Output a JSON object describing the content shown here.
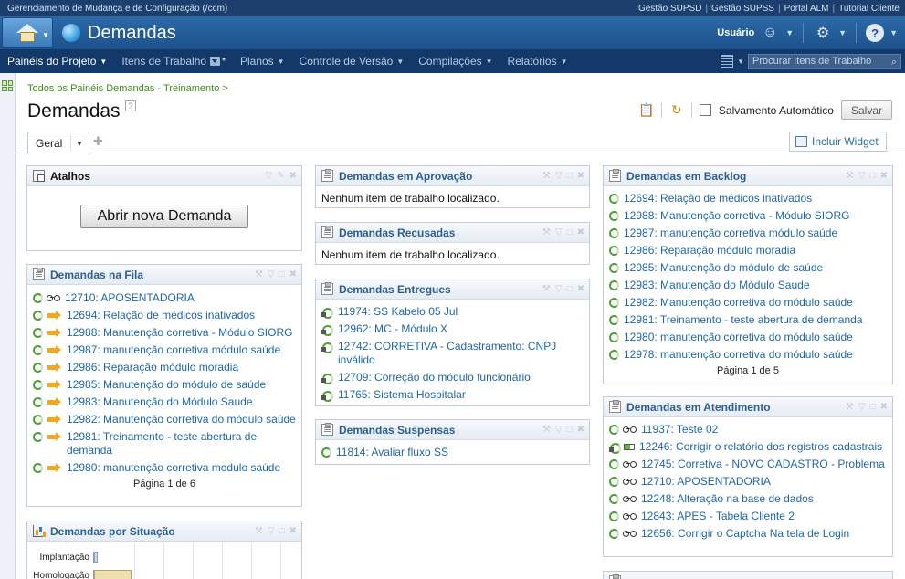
{
  "topstrip": {
    "app_title": "Gerenciamento de Mudança e de Configuração (/ccm)",
    "links": [
      "Gestão SUPSD",
      "Gestão SUPSS",
      "Portal ALM",
      "Tutorial Cliente"
    ]
  },
  "titlebar": {
    "project_title": "Demandas",
    "user_label": "Usuário"
  },
  "nav": {
    "items": [
      {
        "label": "Painéis do Projeto"
      },
      {
        "label": "Itens de Trabalho"
      },
      {
        "label": "Planos"
      },
      {
        "label": "Controle de Versão"
      },
      {
        "label": "Compilações"
      },
      {
        "label": "Relatórios"
      }
    ],
    "search_placeholder": "Procurar Itens de Trabalho"
  },
  "page": {
    "breadcrumb": "Todos os Painéis Demandas - Treinamento >",
    "title": "Demandas",
    "autosave_label": "Salvamento Automático",
    "save_label": "Salvar",
    "add_widget_label": "Incluir Widget",
    "tab_label": "Geral"
  },
  "widgets": {
    "atalhos": {
      "title": "Atalhos",
      "button": "Abrir nova Demanda"
    },
    "fila": {
      "title": "Demandas na Fila",
      "items": [
        "12710: APOSENTADORIA",
        "12694: Relação de médicos inativados",
        "12988: Manutenção corretiva - Módulo SIORG",
        "12987: manutenção corretiva módulo saúde",
        "12986: Reparação módulo moradia",
        "12985: Manutenção do módulo de saúde",
        "12983: Manutenção do Módulo Saude",
        "12982: Manutenção corretiva do módulo saúde",
        "12981: Treinamento - teste abertura de demanda",
        "12980: manutenção corretiva modulo saúde"
      ],
      "pager": "Página 1 de 6"
    },
    "situacao": {
      "title": "Demandas por Situação"
    },
    "aprovacao": {
      "title": "Demandas em Aprovação",
      "empty": "Nenhum item de trabalho localizado."
    },
    "recusadas": {
      "title": "Demandas Recusadas",
      "empty": "Nenhum item de trabalho localizado."
    },
    "entregues": {
      "title": "Demandas Entregues",
      "items": [
        "11974: SS Kabelo 05 Jul",
        "12962: MC - Módulo X",
        "12742: CORRETIVA - Cadastramento: CNPJ inválido",
        "12709: Correção do módulo funcionário",
        "11765: Sistema Hospitalar"
      ]
    },
    "suspensas": {
      "title": "Demandas Suspensas",
      "items": [
        "11814: Avaliar fluxo SS"
      ]
    },
    "backlog": {
      "title": "Demandas em Backlog",
      "items": [
        "12694: Relação de médicos inativados",
        "12988: Manutenção corretiva - Módulo SIORG",
        "12987: manutenção corretiva módulo saúde",
        "12986: Reparação módulo moradia",
        "12985: Manutenção do módulo de saúde",
        "12983: Manutenção do Módulo Saude",
        "12982: Manutenção corretiva do módulo saúde",
        "12981: Treinamento - teste abertura de demanda",
        "12980: manutenção corretiva do módulo saúde",
        "12978: manutenção corretiva do módulo saúde"
      ],
      "pager": "Página 1 de 5"
    },
    "atendimento": {
      "title": "Demandas em Atendimento",
      "items": [
        "11937: Teste 02",
        "12246: Corrigir o relatório dos registros cadastrais",
        "12745: Corretiva - NOVO CADASTRO - Problema",
        "12710: APOSENTADORIA",
        "12248: Alteração na base de dados",
        "12843: APES - Tabela Cliente 2",
        "12656: Corrigir o Captcha Na tela de Login"
      ]
    }
  },
  "chart_data": {
    "type": "bar",
    "categories": [
      "Implantação",
      "Homologação"
    ],
    "values": [
      1,
      12
    ],
    "xlim": [
      0,
      60
    ]
  }
}
